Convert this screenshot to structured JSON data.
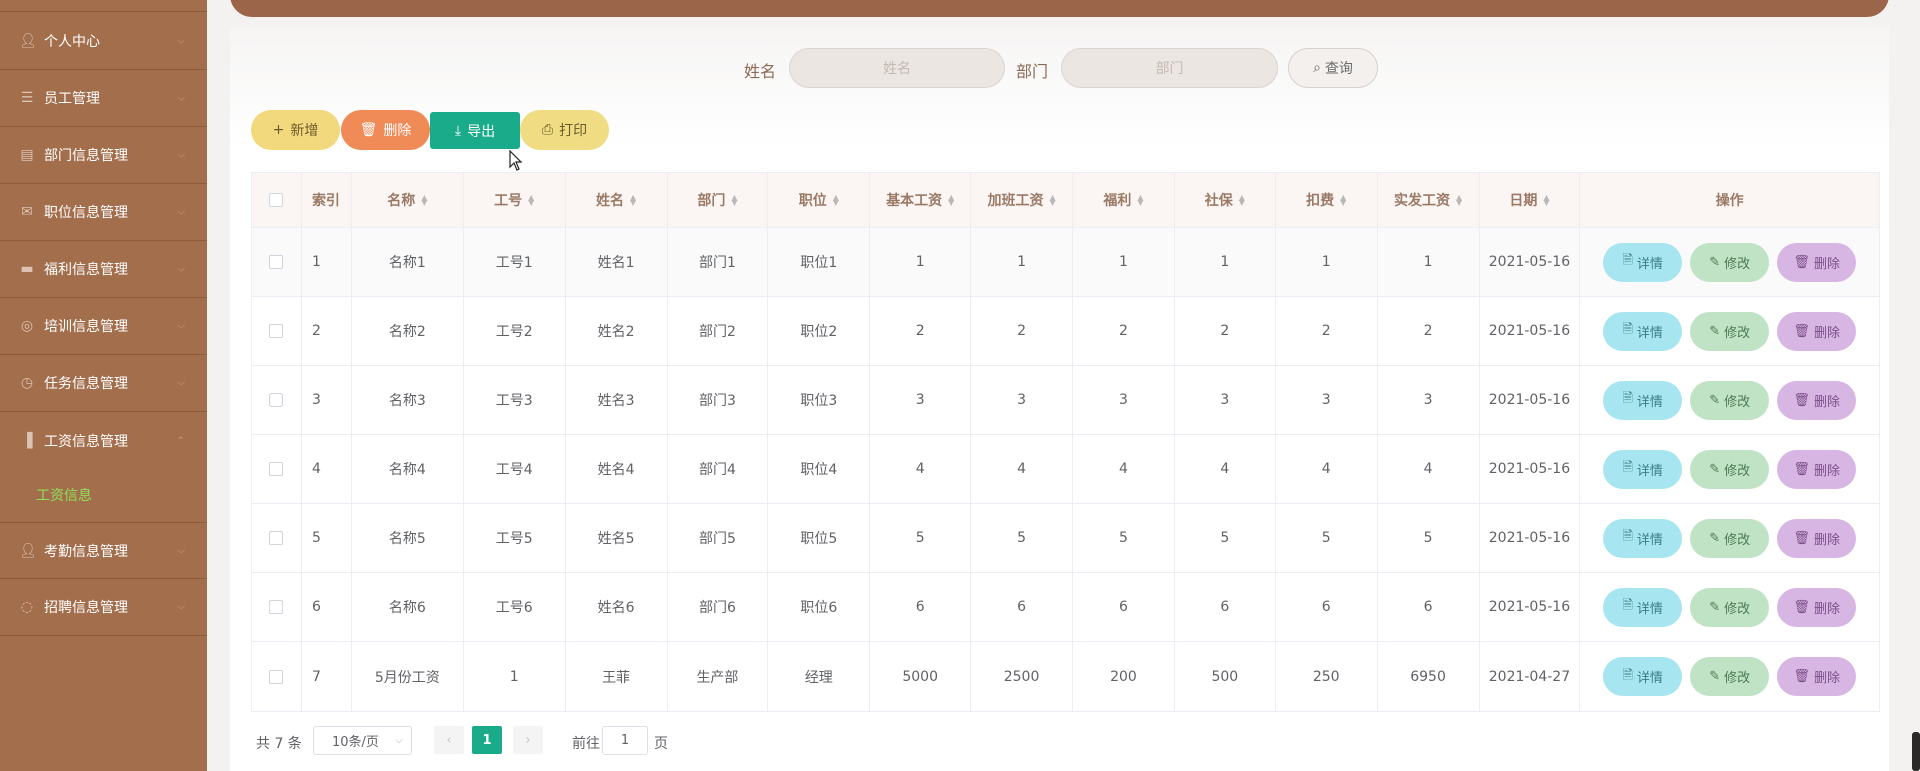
{
  "sidebar": {
    "items": [
      {
        "label": "个人中心",
        "icon": "user-icon"
      },
      {
        "label": "员工管理",
        "icon": "list-icon"
      },
      {
        "label": "部门信息管理",
        "icon": "building-icon"
      },
      {
        "label": "职位信息管理",
        "icon": "mail-icon"
      },
      {
        "label": "福利信息管理",
        "icon": "storage-icon"
      },
      {
        "label": "培训信息管理",
        "icon": "compass-icon"
      },
      {
        "label": "任务信息管理",
        "icon": "clock-icon"
      },
      {
        "label": "工资信息管理",
        "icon": "bar-chart-icon"
      },
      {
        "label": "考勤信息管理",
        "icon": "user-icon"
      },
      {
        "label": "招聘信息管理",
        "icon": "loading-icon"
      }
    ],
    "active_sub": "工资信息"
  },
  "search": {
    "name_label": "姓名",
    "name_placeholder": "姓名",
    "dept_label": "部门",
    "dept_placeholder": "部门",
    "query_label": "查询"
  },
  "actions": {
    "add": "新增",
    "delete": "删除",
    "export": "导出",
    "print": "打印"
  },
  "table": {
    "headers": [
      "索引",
      "名称",
      "工号",
      "姓名",
      "部门",
      "职位",
      "基本工资",
      "加班工资",
      "福利",
      "社保",
      "扣费",
      "实发工资",
      "日期",
      "操作"
    ],
    "rows": [
      [
        "1",
        "名称1",
        "工号1",
        "姓名1",
        "部门1",
        "职位1",
        "1",
        "1",
        "1",
        "1",
        "1",
        "1",
        "2021-05-16"
      ],
      [
        "2",
        "名称2",
        "工号2",
        "姓名2",
        "部门2",
        "职位2",
        "2",
        "2",
        "2",
        "2",
        "2",
        "2",
        "2021-05-16"
      ],
      [
        "3",
        "名称3",
        "工号3",
        "姓名3",
        "部门3",
        "职位3",
        "3",
        "3",
        "3",
        "3",
        "3",
        "3",
        "2021-05-16"
      ],
      [
        "4",
        "名称4",
        "工号4",
        "姓名4",
        "部门4",
        "职位4",
        "4",
        "4",
        "4",
        "4",
        "4",
        "4",
        "2021-05-16"
      ],
      [
        "5",
        "名称5",
        "工号5",
        "姓名5",
        "部门5",
        "职位5",
        "5",
        "5",
        "5",
        "5",
        "5",
        "5",
        "2021-05-16"
      ],
      [
        "6",
        "名称6",
        "工号6",
        "姓名6",
        "部门6",
        "职位6",
        "6",
        "6",
        "6",
        "6",
        "6",
        "6",
        "2021-05-16"
      ],
      [
        "7",
        "5月份工资",
        "1",
        "王菲",
        "生产部",
        "经理",
        "5000",
        "2500",
        "200",
        "500",
        "250",
        "6950",
        "2021-04-27"
      ]
    ],
    "op_detail": "详情",
    "op_edit": "修改",
    "op_delete": "删除"
  },
  "pagination": {
    "total": "共 7 条",
    "page_size": "10条/页",
    "current": "1",
    "goto_label": "前往",
    "goto_value": "1",
    "page_suffix": "页"
  },
  "colors": {
    "sidebar_bg": "#a36e4c",
    "accent": "#1aab8a",
    "active_sub": "#8fe05a"
  }
}
